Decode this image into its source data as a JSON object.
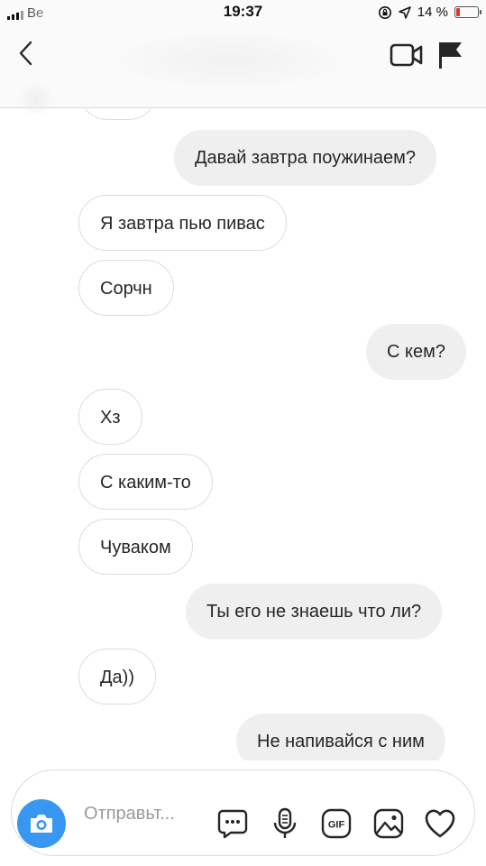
{
  "status_bar": {
    "carrier": "Be",
    "time": "19:37",
    "battery_percent": "14 %",
    "battery_level": 0.14
  },
  "header": {
    "icons": [
      "back-icon",
      "video-call-icon",
      "flag-icon"
    ]
  },
  "conversation": {
    "messages": [
      {
        "direction": "out",
        "text": "Давай завтра поужинаем?"
      },
      {
        "direction": "in",
        "text": "Я завтра пью пивас"
      },
      {
        "direction": "in",
        "text": "Сорчн"
      },
      {
        "direction": "out",
        "text": "С кем?"
      },
      {
        "direction": "in",
        "text": "Хз"
      },
      {
        "direction": "in",
        "text": "С каким-то"
      },
      {
        "direction": "in",
        "text": "Чуваком"
      },
      {
        "direction": "out",
        "text": "Ты его не знаешь что ли?"
      },
      {
        "direction": "in",
        "text": "Да))"
      },
      {
        "direction": "out",
        "text": "Не напивайся с ним"
      }
    ]
  },
  "composer": {
    "placeholder": "Отправьт...",
    "icons": [
      "camera-icon",
      "chat-bubble-icon",
      "microphone-icon",
      "gif-icon",
      "image-icon",
      "heart-icon"
    ]
  },
  "colors": {
    "accent": "#3897f0",
    "outgoing_bubble": "#efefef",
    "incoming_border": "#dbdbdb",
    "battery_low": "#e0332a"
  }
}
